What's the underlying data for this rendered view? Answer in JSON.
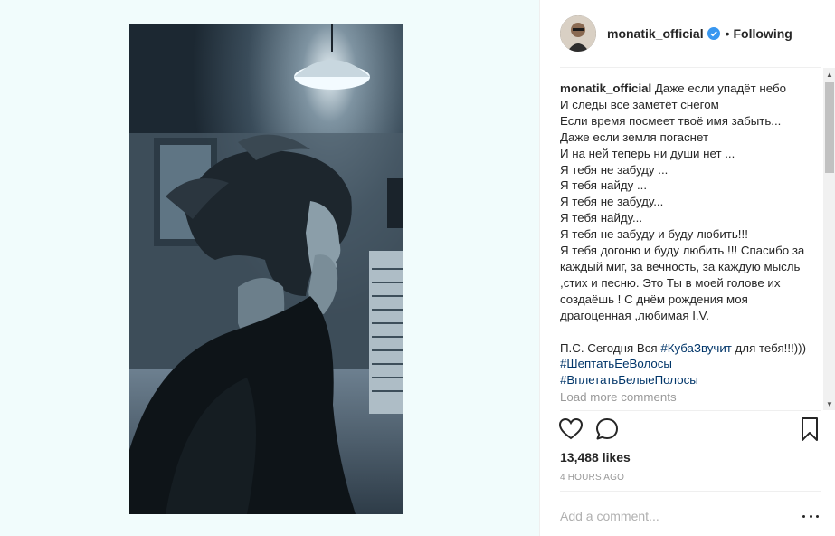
{
  "post": {
    "username": "monatik_official",
    "follow_label": "Following",
    "dot": "•"
  },
  "caption": {
    "username": "monatik_official",
    "text": " Даже если упадёт небо\nИ следы все заметёт снегом\nЕсли время посмеет твоё имя забыть...\nДаже если земля погаснет\nИ на ней теперь ни души нет ...\nЯ тебя не забуду ...\nЯ тебя найду ...\nЯ тебя не забуду...\nЯ тебя найду...\nЯ тебя не забуду и буду любить!!!\nЯ тебя догоню и буду любить !!! Спасибо за каждый миг, за вечность, за каждую мысль ,стих и песню. Это Ты в моей голове их создаёшь ! С днём рождения моя драгоценная ,любимая I.V.\n\nП.С. Сегодня Вся ",
    "tag1": "#КубаЗвучит",
    "between1": " для тебя!!!))) ",
    "tag2": "#ШептатьЕеВолосы",
    "between2": "\n",
    "tag3": "#ВплетатьБелыеПолосы"
  },
  "load_more": "Load more comments",
  "likes": "13,488 likes",
  "time": "4 HOURS AGO",
  "comment_placeholder": "Add a comment...",
  "icons": {
    "verified": "verified-badge-icon",
    "like": "heart-icon",
    "comment": "comment-bubble-icon",
    "save": "bookmark-icon",
    "more": "more-options-icon"
  },
  "colors": {
    "verified": "#3897f0",
    "hashtag": "#003569",
    "media_bg": "#f1fcfc"
  }
}
